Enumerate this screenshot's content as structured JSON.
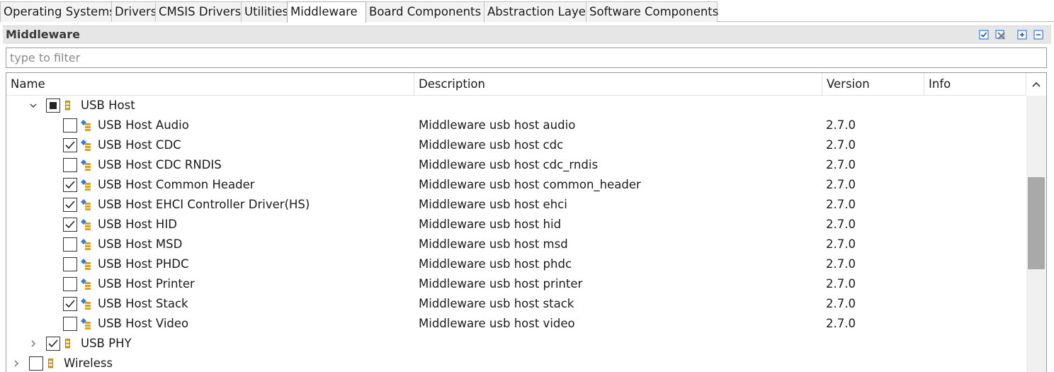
{
  "tabs": [
    {
      "label": "Operating Systems",
      "active": false
    },
    {
      "label": "Drivers",
      "active": false
    },
    {
      "label": "CMSIS Drivers",
      "active": false
    },
    {
      "label": "Utilities",
      "active": false
    },
    {
      "label": "Middleware",
      "active": true
    },
    {
      "label": "Board Components",
      "active": false
    },
    {
      "label": "Abstraction Layer",
      "active": false
    },
    {
      "label": "Software Components",
      "active": false
    }
  ],
  "section": {
    "title": "Middleware",
    "buttons": [
      "check-all-icon",
      "uncheck-all-icon",
      "expand-all-icon",
      "collapse-all-icon"
    ]
  },
  "filter": {
    "placeholder": "type to filter",
    "value": ""
  },
  "columns": {
    "name": "Name",
    "description": "Description",
    "version": "Version",
    "info": "Info"
  },
  "colors": {
    "accent_yellow": "#d9a21b",
    "accent_blue": "#3a7bd5",
    "scroll_thumb": "#a9a9a9"
  },
  "rows": [
    {
      "level": 1,
      "expander": "expanded",
      "check": "partial",
      "icon": "component-group-icon",
      "name": "USB Host",
      "description": "",
      "version": ""
    },
    {
      "level": 2,
      "expander": "none",
      "check": "unchecked",
      "icon": "component-icon",
      "name": "USB Host Audio",
      "description": "Middleware usb host audio",
      "version": "2.7.0"
    },
    {
      "level": 2,
      "expander": "none",
      "check": "checked",
      "icon": "component-icon",
      "name": "USB Host CDC",
      "description": "Middleware usb host cdc",
      "version": "2.7.0"
    },
    {
      "level": 2,
      "expander": "none",
      "check": "unchecked",
      "icon": "component-icon",
      "name": "USB Host CDC RNDIS",
      "description": "Middleware usb host cdc_rndis",
      "version": "2.7.0"
    },
    {
      "level": 2,
      "expander": "none",
      "check": "checked",
      "icon": "component-icon",
      "name": "USB Host Common Header",
      "description": "Middleware usb host common_header",
      "version": "2.7.0"
    },
    {
      "level": 2,
      "expander": "none",
      "check": "checked",
      "icon": "component-icon",
      "name": "USB Host EHCI Controller Driver(HS)",
      "description": "Middleware usb host ehci",
      "version": "2.7.0"
    },
    {
      "level": 2,
      "expander": "none",
      "check": "checked",
      "icon": "component-icon",
      "name": "USB Host HID",
      "description": "Middleware usb host hid",
      "version": "2.7.0"
    },
    {
      "level": 2,
      "expander": "none",
      "check": "unchecked",
      "icon": "component-icon",
      "name": "USB Host MSD",
      "description": "Middleware usb host msd",
      "version": "2.7.0"
    },
    {
      "level": 2,
      "expander": "none",
      "check": "unchecked",
      "icon": "component-icon",
      "name": "USB Host PHDC",
      "description": "Middleware usb host phdc",
      "version": "2.7.0"
    },
    {
      "level": 2,
      "expander": "none",
      "check": "unchecked",
      "icon": "component-icon",
      "name": "USB Host Printer",
      "description": "Middleware usb host printer",
      "version": "2.7.0"
    },
    {
      "level": 2,
      "expander": "none",
      "check": "checked",
      "icon": "component-icon",
      "name": "USB Host Stack",
      "description": "Middleware usb host stack",
      "version": "2.7.0"
    },
    {
      "level": 2,
      "expander": "none",
      "check": "unchecked",
      "icon": "component-icon",
      "name": "USB Host Video",
      "description": "Middleware usb host video",
      "version": "2.7.0"
    },
    {
      "level": 1,
      "expander": "collapsed",
      "check": "checked",
      "icon": "component-group-icon",
      "name": "USB PHY",
      "description": "",
      "version": ""
    },
    {
      "level": 0,
      "expander": "collapsed",
      "check": "unchecked",
      "icon": "component-group-icon",
      "name": "Wireless",
      "description": "",
      "version": ""
    }
  ]
}
